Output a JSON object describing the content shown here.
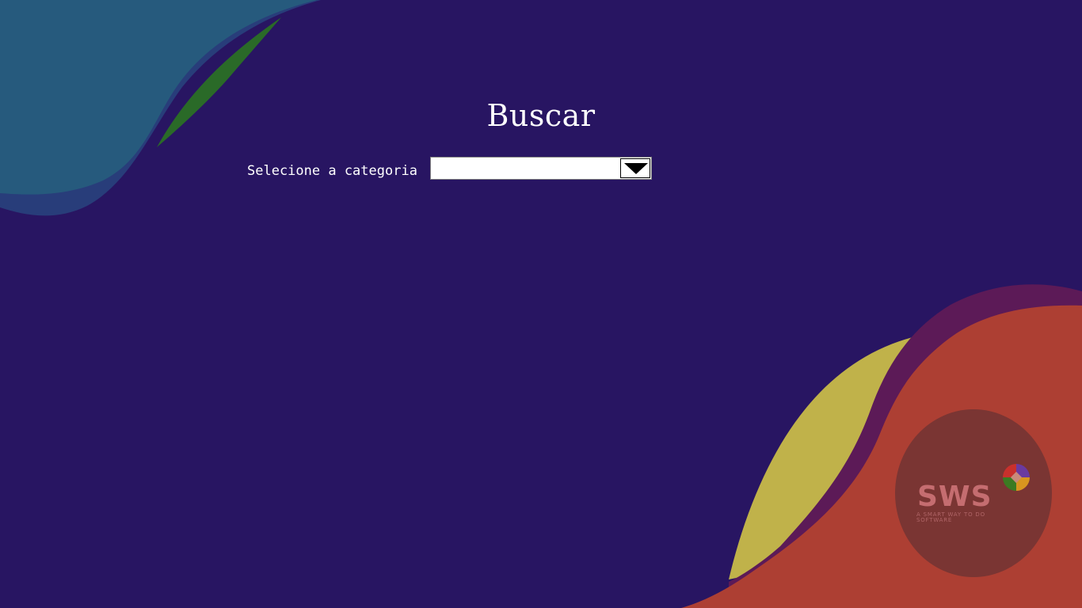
{
  "page": {
    "title": "Buscar"
  },
  "form": {
    "category_label": "Selecione a categoria",
    "category_select": {
      "selected_value": ""
    }
  },
  "logo": {
    "name": "SWS",
    "tagline": "A SMART WAY TO DO SOFTWARE"
  },
  "theme": {
    "background": "#281562",
    "teal_shape": "#265a7d",
    "green_accent": "#2a6a28",
    "yellow_shape": "#c0b24a",
    "purple_shape": "#5c1a57",
    "orange_shape": "#ad3f33",
    "logo_circle": "#7a3533"
  },
  "icons": {
    "dropdown": "triangle-down",
    "logo_emblem": "four-color-circle"
  }
}
